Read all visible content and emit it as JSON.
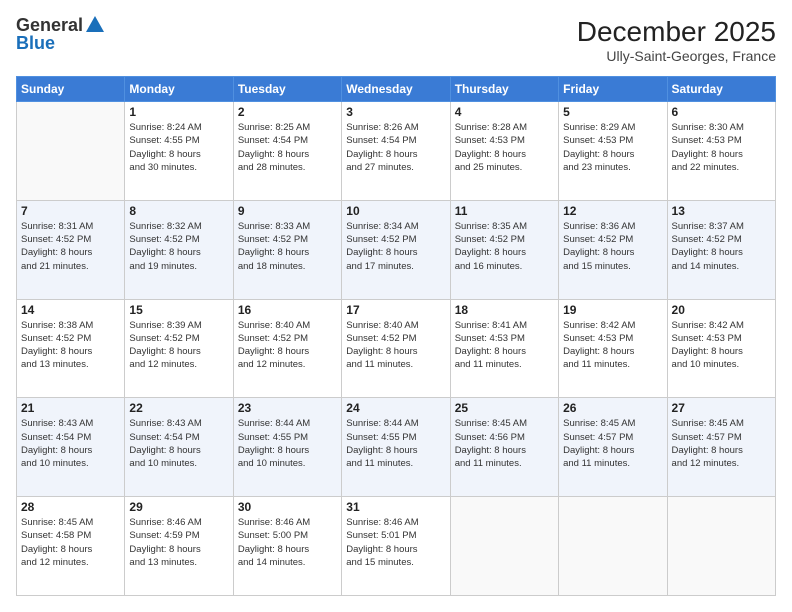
{
  "header": {
    "logo_general": "General",
    "logo_blue": "Blue",
    "month_title": "December 2025",
    "subtitle": "Ully-Saint-Georges, France"
  },
  "days_of_week": [
    "Sunday",
    "Monday",
    "Tuesday",
    "Wednesday",
    "Thursday",
    "Friday",
    "Saturday"
  ],
  "weeks": [
    [
      {
        "day": "",
        "info": ""
      },
      {
        "day": "1",
        "info": "Sunrise: 8:24 AM\nSunset: 4:55 PM\nDaylight: 8 hours\nand 30 minutes."
      },
      {
        "day": "2",
        "info": "Sunrise: 8:25 AM\nSunset: 4:54 PM\nDaylight: 8 hours\nand 28 minutes."
      },
      {
        "day": "3",
        "info": "Sunrise: 8:26 AM\nSunset: 4:54 PM\nDaylight: 8 hours\nand 27 minutes."
      },
      {
        "day": "4",
        "info": "Sunrise: 8:28 AM\nSunset: 4:53 PM\nDaylight: 8 hours\nand 25 minutes."
      },
      {
        "day": "5",
        "info": "Sunrise: 8:29 AM\nSunset: 4:53 PM\nDaylight: 8 hours\nand 23 minutes."
      },
      {
        "day": "6",
        "info": "Sunrise: 8:30 AM\nSunset: 4:53 PM\nDaylight: 8 hours\nand 22 minutes."
      }
    ],
    [
      {
        "day": "7",
        "info": "Sunrise: 8:31 AM\nSunset: 4:52 PM\nDaylight: 8 hours\nand 21 minutes."
      },
      {
        "day": "8",
        "info": "Sunrise: 8:32 AM\nSunset: 4:52 PM\nDaylight: 8 hours\nand 19 minutes."
      },
      {
        "day": "9",
        "info": "Sunrise: 8:33 AM\nSunset: 4:52 PM\nDaylight: 8 hours\nand 18 minutes."
      },
      {
        "day": "10",
        "info": "Sunrise: 8:34 AM\nSunset: 4:52 PM\nDaylight: 8 hours\nand 17 minutes."
      },
      {
        "day": "11",
        "info": "Sunrise: 8:35 AM\nSunset: 4:52 PM\nDaylight: 8 hours\nand 16 minutes."
      },
      {
        "day": "12",
        "info": "Sunrise: 8:36 AM\nSunset: 4:52 PM\nDaylight: 8 hours\nand 15 minutes."
      },
      {
        "day": "13",
        "info": "Sunrise: 8:37 AM\nSunset: 4:52 PM\nDaylight: 8 hours\nand 14 minutes."
      }
    ],
    [
      {
        "day": "14",
        "info": "Sunrise: 8:38 AM\nSunset: 4:52 PM\nDaylight: 8 hours\nand 13 minutes."
      },
      {
        "day": "15",
        "info": "Sunrise: 8:39 AM\nSunset: 4:52 PM\nDaylight: 8 hours\nand 12 minutes."
      },
      {
        "day": "16",
        "info": "Sunrise: 8:40 AM\nSunset: 4:52 PM\nDaylight: 8 hours\nand 12 minutes."
      },
      {
        "day": "17",
        "info": "Sunrise: 8:40 AM\nSunset: 4:52 PM\nDaylight: 8 hours\nand 11 minutes."
      },
      {
        "day": "18",
        "info": "Sunrise: 8:41 AM\nSunset: 4:53 PM\nDaylight: 8 hours\nand 11 minutes."
      },
      {
        "day": "19",
        "info": "Sunrise: 8:42 AM\nSunset: 4:53 PM\nDaylight: 8 hours\nand 11 minutes."
      },
      {
        "day": "20",
        "info": "Sunrise: 8:42 AM\nSunset: 4:53 PM\nDaylight: 8 hours\nand 10 minutes."
      }
    ],
    [
      {
        "day": "21",
        "info": "Sunrise: 8:43 AM\nSunset: 4:54 PM\nDaylight: 8 hours\nand 10 minutes."
      },
      {
        "day": "22",
        "info": "Sunrise: 8:43 AM\nSunset: 4:54 PM\nDaylight: 8 hours\nand 10 minutes."
      },
      {
        "day": "23",
        "info": "Sunrise: 8:44 AM\nSunset: 4:55 PM\nDaylight: 8 hours\nand 10 minutes."
      },
      {
        "day": "24",
        "info": "Sunrise: 8:44 AM\nSunset: 4:55 PM\nDaylight: 8 hours\nand 11 minutes."
      },
      {
        "day": "25",
        "info": "Sunrise: 8:45 AM\nSunset: 4:56 PM\nDaylight: 8 hours\nand 11 minutes."
      },
      {
        "day": "26",
        "info": "Sunrise: 8:45 AM\nSunset: 4:57 PM\nDaylight: 8 hours\nand 11 minutes."
      },
      {
        "day": "27",
        "info": "Sunrise: 8:45 AM\nSunset: 4:57 PM\nDaylight: 8 hours\nand 12 minutes."
      }
    ],
    [
      {
        "day": "28",
        "info": "Sunrise: 8:45 AM\nSunset: 4:58 PM\nDaylight: 8 hours\nand 12 minutes."
      },
      {
        "day": "29",
        "info": "Sunrise: 8:46 AM\nSunset: 4:59 PM\nDaylight: 8 hours\nand 13 minutes."
      },
      {
        "day": "30",
        "info": "Sunrise: 8:46 AM\nSunset: 5:00 PM\nDaylight: 8 hours\nand 14 minutes."
      },
      {
        "day": "31",
        "info": "Sunrise: 8:46 AM\nSunset: 5:01 PM\nDaylight: 8 hours\nand 15 minutes."
      },
      {
        "day": "",
        "info": ""
      },
      {
        "day": "",
        "info": ""
      },
      {
        "day": "",
        "info": ""
      }
    ]
  ]
}
